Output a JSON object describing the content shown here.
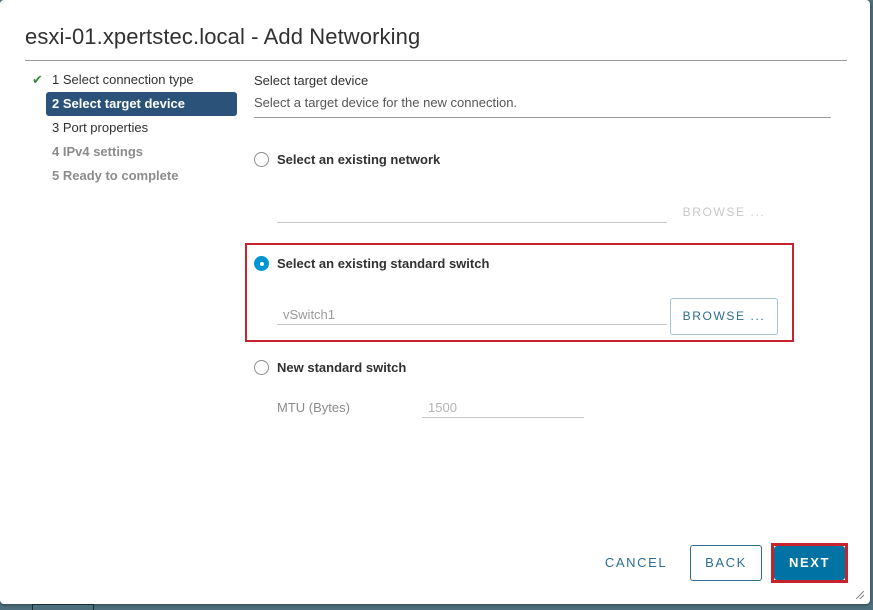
{
  "dialog": {
    "title": "esxi-01.xpertstec.local - Add Networking"
  },
  "steps": [
    {
      "label": "1 Select connection type",
      "state": "completed"
    },
    {
      "label": "2 Select target device",
      "state": "active"
    },
    {
      "label": "3 Port properties",
      "state": "pending"
    },
    {
      "label": "4 IPv4 settings",
      "state": "disabled"
    },
    {
      "label": "5 Ready to complete",
      "state": "disabled"
    }
  ],
  "content": {
    "section_title": "Select target device",
    "section_description": "Select a target device for the new connection.",
    "options": {
      "existing_network": {
        "label": "Select an existing network",
        "selected": false,
        "value": "",
        "browse_label": "BROWSE ..."
      },
      "existing_switch": {
        "label": "Select an existing standard switch",
        "selected": true,
        "value": "vSwitch1",
        "browse_label": "BROWSE ..."
      },
      "new_switch": {
        "label": "New standard switch",
        "selected": false,
        "mtu_label": "MTU (Bytes)",
        "mtu_value": "1500"
      }
    }
  },
  "footer": {
    "cancel_label": "CANCEL",
    "back_label": "BACK",
    "next_label": "NEXT"
  },
  "colors": {
    "accent": "#0072a3",
    "active_step": "#2b5379",
    "highlight": "#c5232e",
    "radio_selected": "#0094d2",
    "check": "#3c8c3c"
  }
}
